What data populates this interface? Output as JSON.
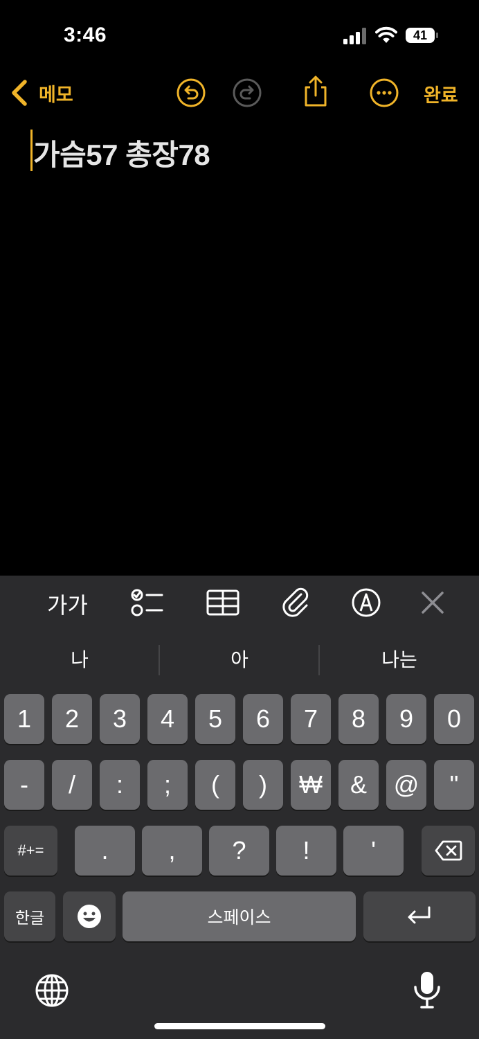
{
  "status_bar": {
    "time": "3:46",
    "battery": "41"
  },
  "nav": {
    "back_label": "메모",
    "done_label": "완료"
  },
  "note": {
    "text": "가슴57 총장78"
  },
  "format_bar": {
    "text_style_label": "가가"
  },
  "suggestions": [
    "나",
    "아",
    "나는"
  ],
  "keyboard": {
    "row1": [
      "1",
      "2",
      "3",
      "4",
      "5",
      "6",
      "7",
      "8",
      "9",
      "0"
    ],
    "row2": [
      "-",
      "/",
      ":",
      ";",
      "(",
      ")",
      "₩",
      "&",
      "@",
      "\""
    ],
    "row3": {
      "mode_label": "#+=",
      "keys": [
        ".",
        ",",
        "?",
        "!",
        "'"
      ]
    },
    "row4": {
      "lang_label": "한글",
      "space_label": "스페이스"
    }
  },
  "colors": {
    "accent": "#f0b429",
    "background": "#000000",
    "keyboard_bg": "#2b2b2d",
    "key": "#6b6b6e",
    "key_dark": "#454547"
  }
}
